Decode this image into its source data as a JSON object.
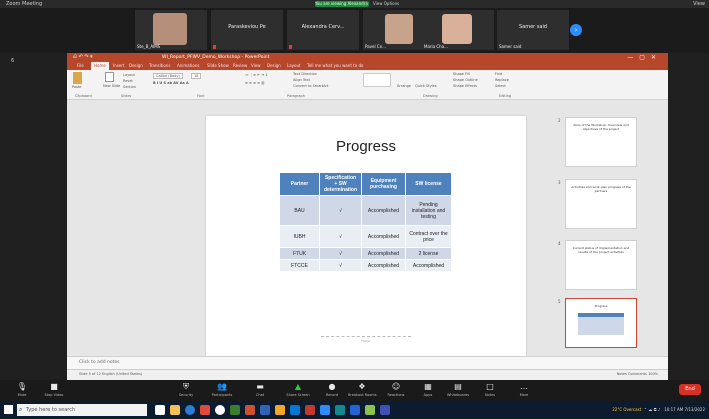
{
  "zoom_window": {
    "title": "Zoom Meeting",
    "recording_label": "You are viewing Alexandra Pavlovska's screen",
    "view_options": "View Options",
    "view_button": "View"
  },
  "participants": [
    {
      "name": "",
      "label": "Ste_B_AIMS",
      "has_video": true,
      "skin": "#b58f7a"
    },
    {
      "name": "Paraskeviou Pe",
      "label": "Paraskeviou Pe",
      "has_video": false
    },
    {
      "name": "Alexandra Cerv...",
      "label": "Alexandra Cerv...",
      "has_video": false
    },
    {
      "name": "",
      "label": "Pavel Ce...",
      "has_video": true,
      "skin": "#c7a38c"
    },
    {
      "name": "",
      "label": "Maria Cha...",
      "has_video": true,
      "skin": "#d9b19a"
    },
    {
      "name": "Samer said",
      "label": "Samer said",
      "has_video": false
    }
  ],
  "left_bar": {
    "participant_count": "6"
  },
  "powerpoint": {
    "title": "WI_Report_PFWV_Demo_Workshop - PowerPoint",
    "tabs": [
      "File",
      "Home",
      "Insert",
      "Design",
      "Transitions",
      "Animations",
      "Slide Show",
      "Review",
      "View",
      "Design",
      "Layout",
      "Tell me what you want to do"
    ],
    "active_tab": "Home",
    "ribbon_groups": [
      "Clipboard",
      "Slides",
      "Font",
      "Paragraph",
      "Drawing",
      "Editing"
    ],
    "ribbon_items": {
      "paste": "Paste",
      "new_slide": "New Slide",
      "layout": "Layout",
      "reset": "Reset",
      "section": "Section",
      "font_name": "Calibri (Body)",
      "font_size": "18",
      "shape_fill": "Shape Fill",
      "shape_outline": "Shape Outline",
      "shape_effects": "Shape Effects",
      "find": "Find",
      "replace": "Replace",
      "select": "Select",
      "arrange": "Arrange",
      "quick_styles": "Quick Styles",
      "text_direction": "Text Direction",
      "align_text": "Align Text",
      "convert_smartart": "Convert to SmartArt"
    },
    "slide": {
      "title": "Progress",
      "table": {
        "headers": [
          "Partner",
          "Specification + SW determination",
          "Equipment purchasing",
          "SW license"
        ],
        "rows": [
          [
            "BAU",
            "√",
            "Accomplished",
            "Pending installation and testing"
          ],
          [
            "IUBH",
            "√",
            "Accomplished",
            "Contract over the price"
          ],
          [
            "FTUK",
            "√",
            "Accomplished",
            "2 license"
          ],
          [
            "FTCCE",
            "√",
            "Accomplished",
            "Accomplished"
          ]
        ]
      },
      "footer_text": "Footer"
    },
    "thumbnails": [
      {
        "num": "2",
        "text": "Aims of the Workshop: Overview and objectives of the project"
      },
      {
        "num": "3",
        "text": "Activities and work plan progress of the partners"
      },
      {
        "num": "4",
        "text": "Current status of implementation and results of the project activities"
      },
      {
        "num": "5",
        "text": "Progress",
        "selected": true
      },
      {
        "num": "6",
        "text": "Next steps and discussion"
      }
    ],
    "notes_placeholder": "Click to add notes",
    "status_left": "Slide 5 of 12   English (United States)",
    "status_right": "Notes   Comments        100%"
  },
  "zoom_controls": [
    {
      "name": "mute",
      "icon": "🎙",
      "label": "Mute"
    },
    {
      "name": "stop-video",
      "icon": "■",
      "label": "Stop Video"
    },
    {
      "name": "security",
      "icon": "🛡",
      "label": "Security"
    },
    {
      "name": "participants",
      "icon": "👥",
      "label": "Participants"
    },
    {
      "name": "chat",
      "icon": "▬",
      "label": "Chat"
    },
    {
      "name": "share-screen",
      "icon": "▲",
      "label": "Share Screen"
    },
    {
      "name": "record",
      "icon": "●",
      "label": "Record"
    },
    {
      "name": "breakout-rooms",
      "icon": "❖",
      "label": "Breakout Rooms"
    },
    {
      "name": "reactions",
      "icon": "☺",
      "label": "Reactions"
    },
    {
      "name": "apps",
      "icon": "▦",
      "label": "Apps"
    },
    {
      "name": "whiteboards",
      "icon": "▤",
      "label": "Whiteboards"
    },
    {
      "name": "notes",
      "icon": "□",
      "label": "Notes"
    },
    {
      "name": "more",
      "icon": "…",
      "label": "More"
    }
  ],
  "end_button": "End",
  "taskbar": {
    "search_placeholder": "Type here to search",
    "weather": "22°C  Overcast",
    "time": "10:17 AM",
    "date": "7/13/2022"
  }
}
